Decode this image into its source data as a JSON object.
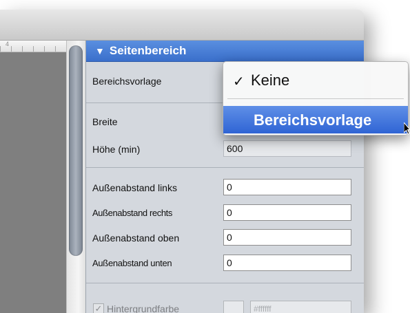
{
  "ruler": {
    "tick_label": "4"
  },
  "inspector": {
    "section_title": "Seitenbereich",
    "rows": {
      "template_label": "Bereichsvorlage",
      "width_label": "Breite",
      "height_label": "Höhe (min)",
      "height_value": "600",
      "margin_left_label": "Außenabstand links",
      "margin_left_value": "0",
      "margin_right_label": "Außenabstand rechts",
      "margin_right_value": "0",
      "margin_top_label": "Außenabstand oben",
      "margin_top_value": "0",
      "margin_bottom_label": "Außenabstand unten",
      "margin_bottom_value": "0",
      "background_label": "Hintergrundfarbe",
      "background_value": "#ffffff"
    }
  },
  "dropdown": {
    "items": [
      {
        "label": "Keine",
        "checked": true
      },
      {
        "label": "Bereichsvorlage",
        "highlighted": true
      }
    ]
  },
  "colors": {
    "header_blue": "#3a6fcb",
    "selection_blue": "#2f64d4",
    "panel_bg": "#d4d8de"
  },
  "icons": {
    "disclosure": "triangle-down-icon",
    "check": "checkmark-icon",
    "cursor": "arrow-cursor-icon"
  }
}
